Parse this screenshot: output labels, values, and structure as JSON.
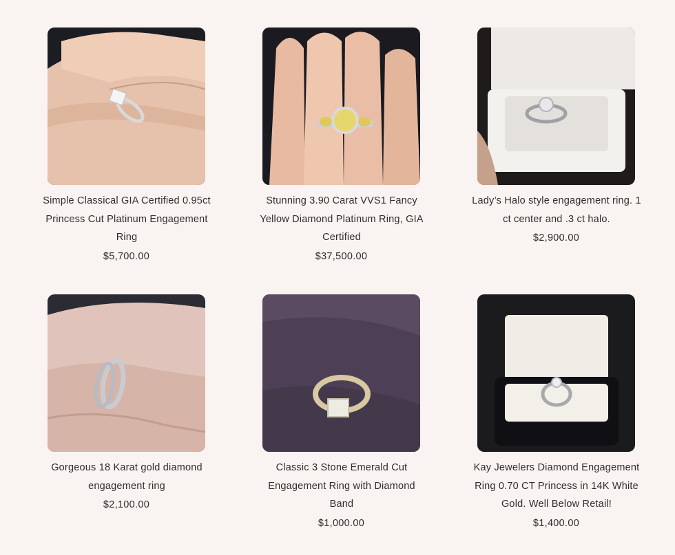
{
  "products": [
    {
      "title": "Simple Classical GIA Certified 0.95ct Princess Cut Platinum Engagement Ring",
      "price": "$5,700.00",
      "image": "ring-on-finger-photo"
    },
    {
      "title": "Stunning 3.90 Carat VVS1 Fancy Yellow Diamond Platinum Ring, GIA Certified",
      "price": "$37,500.00",
      "image": "yellow-diamond-ring-photo"
    },
    {
      "title": "Lady’s Halo style engagement ring. 1 ct center and .3 ct halo.",
      "price": "$2,900.00",
      "image": "ring-in-white-box-photo"
    },
    {
      "title": "Gorgeous 18 Karat gold diamond engagement ring",
      "price": "$2,100.00",
      "image": "ring-set-on-hand-photo"
    },
    {
      "title": "Classic 3 Stone Emerald Cut Engagement Ring with Diamond Band",
      "price": "$1,000.00",
      "image": "ring-on-purple-fabric-photo"
    },
    {
      "title": "Kay Jewelers Diamond Engagement Ring 0.70 CT Princess in 14K White Gold. Well Below Retail!",
      "price": "$1,400.00",
      "image": "ring-in-black-box-photo"
    }
  ],
  "colors": {
    "background": "#f9f3f1",
    "text": "#2e2e2e"
  }
}
